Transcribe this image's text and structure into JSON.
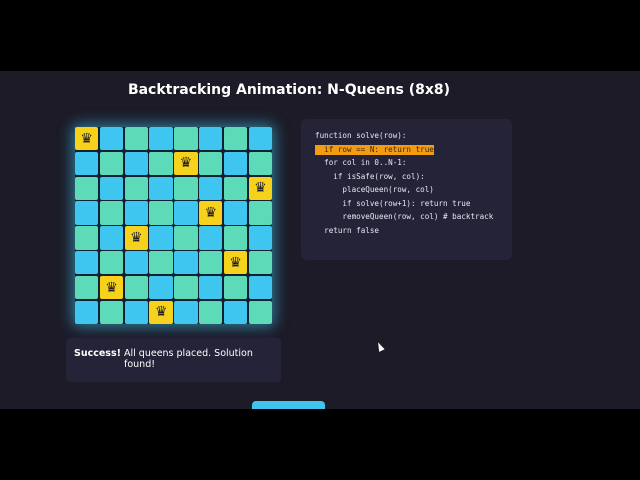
{
  "title": "Backtracking Animation: N-Queens (8x8)",
  "board": {
    "size": 8,
    "queen_columns_by_row": [
      0,
      4,
      7,
      5,
      2,
      6,
      1,
      3
    ],
    "queen_icon": "♛",
    "colors": {
      "light": "#5ddbb8",
      "dark": "#3ec5f0",
      "queen": "#f7d21c"
    }
  },
  "code": {
    "lines": [
      "function solve(row):",
      "  if row == N: return true",
      "  for col in 0..N-1:",
      "    if isSafe(row, col):",
      "      placeQueen(row, col)",
      "      if solve(row+1): return true",
      "      removeQueen(row, col) # backtrack",
      "  return false"
    ],
    "highlighted_line": 1
  },
  "status": {
    "bold": "Success!",
    "text": "All queens placed. Solution found!"
  }
}
